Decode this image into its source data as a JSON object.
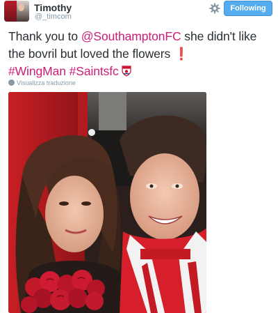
{
  "user": {
    "name": "Timothy",
    "handle": "@_timcom"
  },
  "actions": {
    "follow_label": "Following"
  },
  "tweet": {
    "text_1": "Thank you to ",
    "mention": "@SouthamptonFC",
    "text_2": " she didn't like the bovril but loved the flowers",
    "emoji_exclamation": "❗",
    "hashtag_1": "#WingMan",
    "hashtag_2": "#Saintsfc",
    "link_color": "#cc1e77"
  },
  "translate_label": "Visualizza traduzione",
  "colors": {
    "follow_button": "#55acee",
    "name": "#292f33",
    "muted": "#8899a6"
  },
  "icons": [
    "gear-icon",
    "globe-icon",
    "southampton-crest-icon"
  ]
}
